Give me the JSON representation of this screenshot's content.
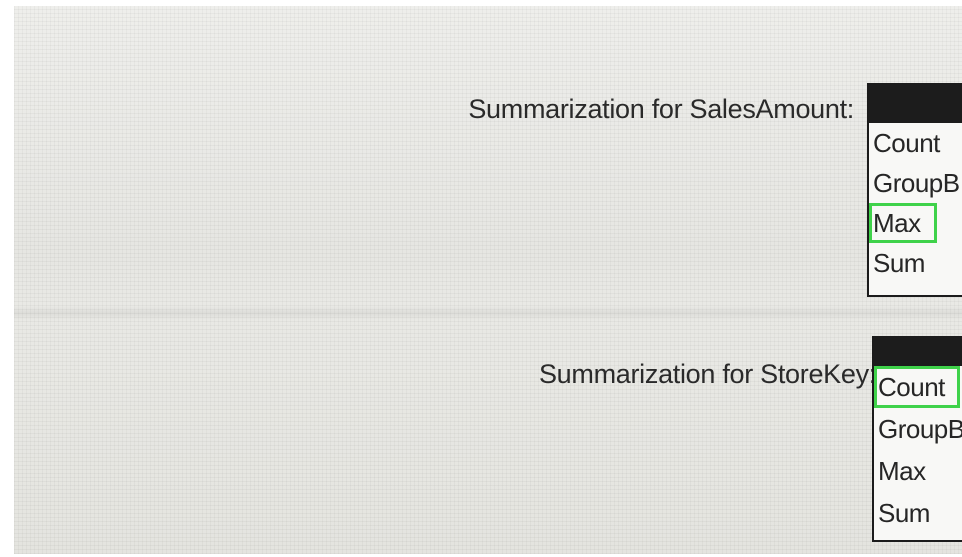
{
  "sales_amount": {
    "label": "Summarization for SalesAmount:",
    "options": [
      "Count",
      "GroupB",
      "Max",
      "Sum"
    ],
    "selected": "Max"
  },
  "store_key": {
    "label": "Summarization for StoreKey:",
    "options": [
      "Count",
      "GroupB",
      "Max",
      "Sum"
    ],
    "selected": "Count"
  },
  "colors": {
    "selection_outline": "#3fd24a",
    "dropdown_header": "#1c1c1c"
  }
}
